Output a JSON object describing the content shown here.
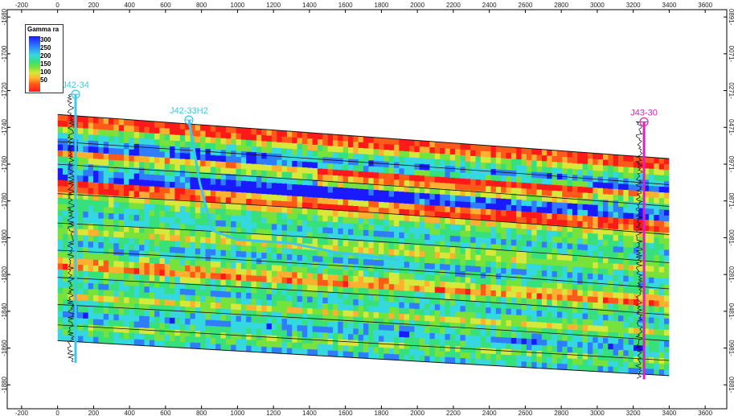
{
  "chart_data": {
    "type": "heatmap",
    "x_ticks": [
      "-200",
      "0",
      "200",
      "400",
      "600",
      "800",
      "1000",
      "1200",
      "1400",
      "1600",
      "1800",
      "2000",
      "2200",
      "2400",
      "2600",
      "2800",
      "3000",
      "3200",
      "3400",
      "3600"
    ],
    "y_ticks": [
      "-1680",
      "-1700",
      "-1720",
      "-1740",
      "-1760",
      "-1780",
      "-1800",
      "-1820",
      "-1840",
      "-1860",
      "-1880"
    ],
    "right_y_ticks": [
      "0891-",
      "0071-",
      "0271-",
      "0471-",
      "0971-",
      "0871-",
      "0081-",
      "0281-",
      "0481-",
      "0981-",
      "0881-"
    ],
    "xlim": [
      -280,
      3720
    ],
    "ylim": [
      -1893,
      -1676
    ],
    "colorbar": {
      "title": "Gamma ra",
      "ticks": [
        "300",
        "250",
        "200",
        "150",
        "100",
        "50"
      ],
      "colors": [
        "#1a1aff",
        "#2f7cff",
        "#36d8e0",
        "#37e07a",
        "#77e23b",
        "#d8e83a",
        "#ffb030",
        "#ff5a1a",
        "#ff1a1a"
      ]
    },
    "wells": [
      {
        "name": "J42-34",
        "color": "#3cc8e8",
        "top": [
          100,
          -1722
        ],
        "path": [
          [
            100,
            -1722
          ],
          [
            100,
            -1868
          ]
        ]
      },
      {
        "name": "J42-33H2",
        "color": "#3cc8e8",
        "top": [
          730,
          -1736
        ],
        "path": [
          [
            730,
            -1736
          ],
          [
            790,
            -1770
          ],
          [
            860,
            -1796
          ],
          [
            1000,
            -1801
          ],
          [
            1300,
            -1803
          ],
          [
            1550,
            -1808
          ],
          [
            1900,
            -1812
          ]
        ]
      },
      {
        "name": "J43-30",
        "color": "#e020c0",
        "top": [
          3260,
          -1737
        ],
        "path": [
          [
            3260,
            -1737
          ],
          [
            3260,
            -1877
          ]
        ]
      }
    ],
    "model": {
      "x_left": 0,
      "x_right": 3400,
      "top_left": -1733,
      "top_right": -1757,
      "base_left": -1856,
      "base_right": -1875
    }
  }
}
